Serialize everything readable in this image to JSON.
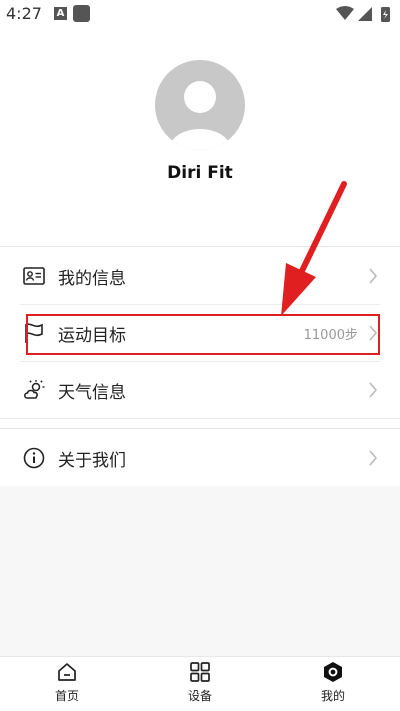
{
  "status_bar": {
    "time": "4:27",
    "notif_badge": "A"
  },
  "profile": {
    "username": "Diri Fit"
  },
  "menu_items": [
    {
      "label": "我的信息",
      "icon": "id-card-icon"
    },
    {
      "label": "运动目标",
      "icon": "flag-icon",
      "value": "11000步"
    },
    {
      "label": "天气信息",
      "icon": "weather-icon"
    }
  ],
  "menu_items_2": [
    {
      "label": "关于我们",
      "icon": "info-icon"
    }
  ],
  "tabs": [
    {
      "label": "首页",
      "icon": "home-icon"
    },
    {
      "label": "设备",
      "icon": "grid-icon"
    },
    {
      "label": "我的",
      "icon": "hexagon-icon",
      "active": true
    }
  ],
  "annotation_color": "#e02020"
}
